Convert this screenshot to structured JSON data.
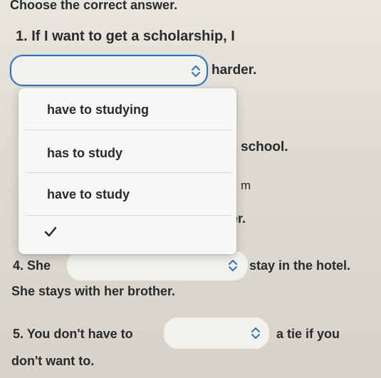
{
  "instruction": "Choose the correct answer.",
  "q1": {
    "prompt": "1. If I want to get a scholarship, I",
    "after_text": "harder.",
    "select_value": "",
    "options": [
      "have to studying",
      "has to study",
      "have to study",
      ""
    ]
  },
  "hidden_fragments": {
    "school": "school.",
    "m": "m",
    "er": "er."
  },
  "q4": {
    "prompt": "4. She",
    "after_text": "stay in the hotel.",
    "select_value": "",
    "context": "She stays with her brother."
  },
  "q5": {
    "prompt": "5. You don't have to",
    "after_text": "a tie if you",
    "line2": "don't want to.",
    "select_value": ""
  },
  "colors": {
    "focus_border": "#2f70b8",
    "select_bg": "#f2f1ed"
  },
  "icons": {
    "select_chevron": "up-down-chevron-icon",
    "checkmark": "check-icon"
  }
}
